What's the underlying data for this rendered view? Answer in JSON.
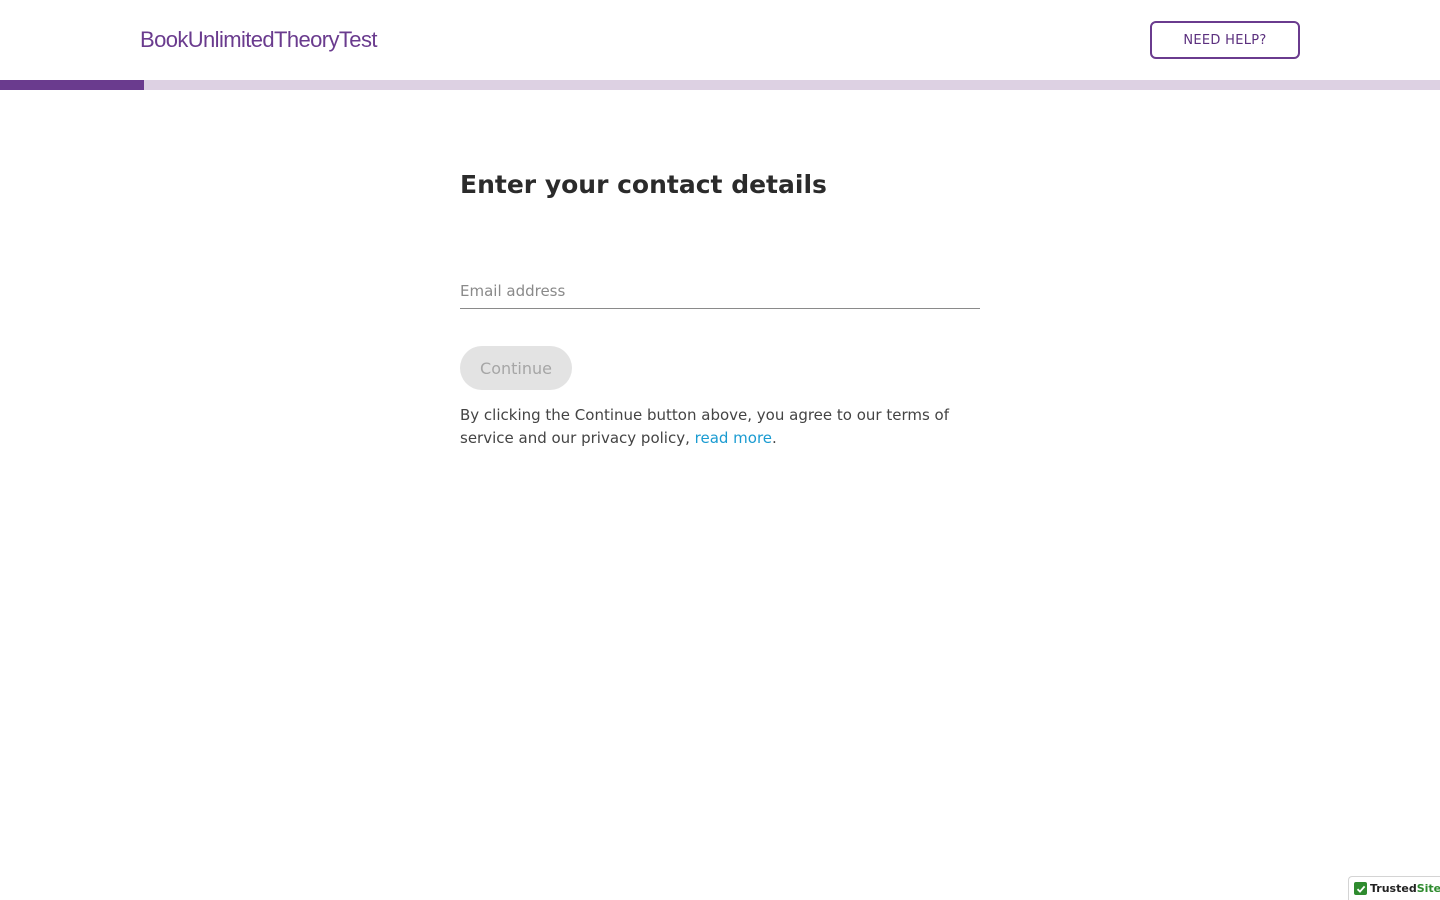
{
  "header": {
    "logo_text": "BookUnlimitedTheoryTest",
    "help_button_label": "NEED HELP?"
  },
  "progress": {
    "fraction_complete": 0.1,
    "fill_color": "#6a3b8e",
    "track_color": "#ddd1e3"
  },
  "form": {
    "title": "Enter your contact details",
    "email_placeholder": "Email address",
    "email_value": "",
    "continue_label": "Continue",
    "continue_enabled": false,
    "terms_text": "By clicking the Continue button above, you agree to our terms of service and our privacy policy, ",
    "terms_link_label": "read more",
    "terms_end": "."
  },
  "badge": {
    "name": "Trusted",
    "suffix": "Site",
    "icon": "checkmark-icon"
  },
  "colors": {
    "brand": "#6a3b8e",
    "link": "#1a9bd1",
    "trusted_green": "#2e8b2e"
  }
}
